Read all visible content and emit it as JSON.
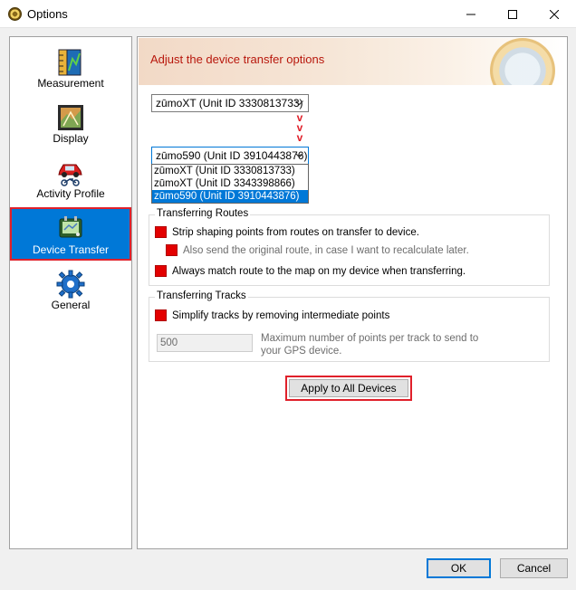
{
  "window": {
    "title": "Options"
  },
  "sidebar": {
    "items": [
      {
        "label": "Measurement",
        "icon": "ruler-icon"
      },
      {
        "label": "Display",
        "icon": "map-display-icon"
      },
      {
        "label": "Activity Profile",
        "icon": "car-bike-icon"
      },
      {
        "label": "Device Transfer",
        "icon": "gps-device-icon",
        "selected": true
      },
      {
        "label": "General",
        "icon": "gear-icon"
      }
    ]
  },
  "banner": {
    "title": "Adjust the device transfer options",
    "icon": "compass-icon"
  },
  "transfer": {
    "source_device": "zūmoXT (Unit ID 3330813733)",
    "target_device": "zūmo590 (Unit ID 3910443876)",
    "arrow_glyph": "v",
    "options": [
      "zūmoXT (Unit ID 3330813733)",
      "zūmoXT (Unit ID 3343398866)",
      "zūmo590 (Unit ID 3910443876)"
    ]
  },
  "routes": {
    "title": "Transferring Routes",
    "strip_shaping": "Strip shaping points from routes on transfer to device.",
    "send_original": "Also send the original route, in case I want to recalculate later.",
    "always_match": "Always match route to the map on my device when transferring."
  },
  "tracks": {
    "title": "Transferring Tracks",
    "simplify": "Simplify tracks by removing intermediate points",
    "max_points_value": "500",
    "max_points_help": "Maximum number of points per track to send to your GPS device."
  },
  "buttons": {
    "apply_all": "Apply to All Devices",
    "ok": "OK",
    "cancel": "Cancel"
  },
  "colors": {
    "accent": "#0078d7",
    "highlight": "#e0202a",
    "banner_text": "#b8170c",
    "checkbox": "#e30000"
  }
}
